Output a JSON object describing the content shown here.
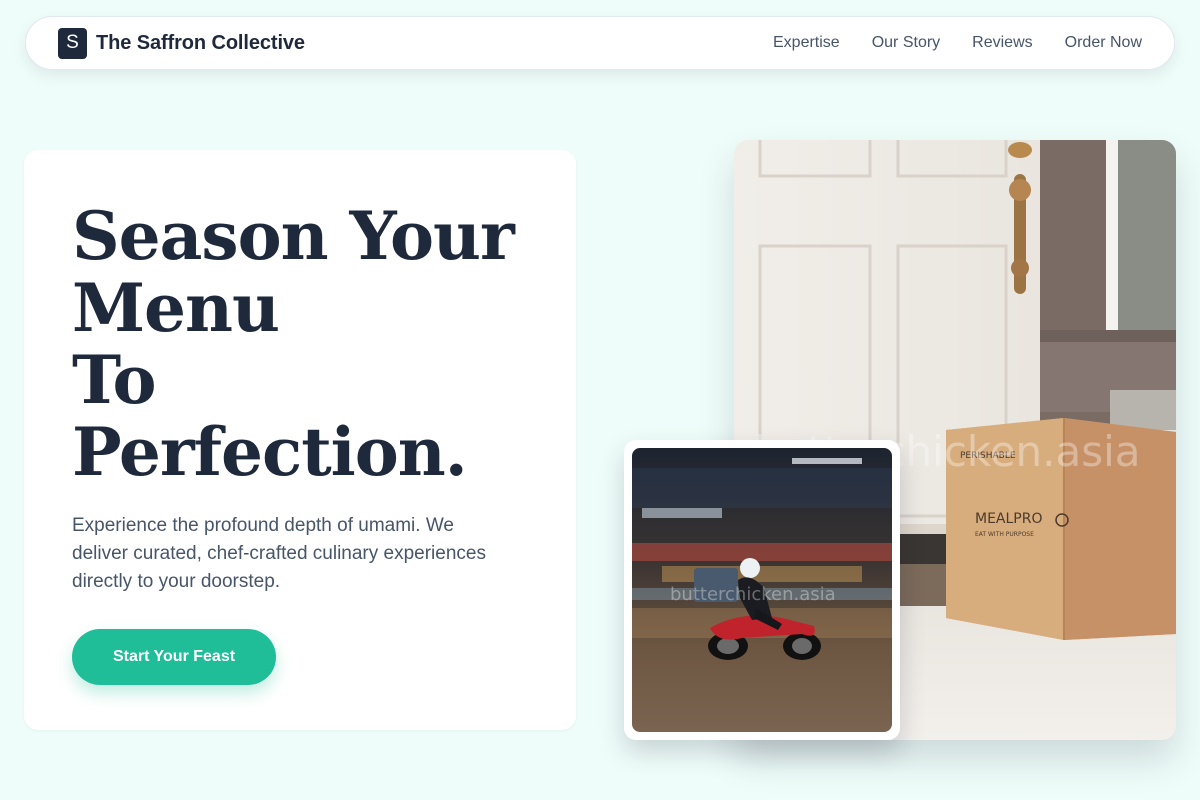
{
  "header": {
    "logo_letter": "S",
    "brand": "The Saffron Collective",
    "nav": [
      {
        "label": "Expertise"
      },
      {
        "label": "Our Story"
      },
      {
        "label": "Reviews"
      },
      {
        "label": "Order Now"
      }
    ]
  },
  "hero": {
    "title_lines": [
      "Season Your",
      "Menu",
      "To",
      "Perfection."
    ],
    "subtitle": "Experience the profound depth of umami. We deliver curated, chef-crafted culinary experiences directly to your doorstep.",
    "cta_label": "Start Your Feast"
  },
  "images": {
    "main": {
      "box_brand": "MEALPRO",
      "box_tagline": "EAT WITH PURPOSE",
      "box_label": "PERISHABLE",
      "watermark": "butterchicken.asia"
    },
    "small": {
      "watermark": "butterchicken.asia"
    }
  },
  "colors": {
    "background": "#effdfa",
    "accent": "#1fbd98",
    "text_dark": "#1e293b",
    "text_muted": "#475569"
  }
}
